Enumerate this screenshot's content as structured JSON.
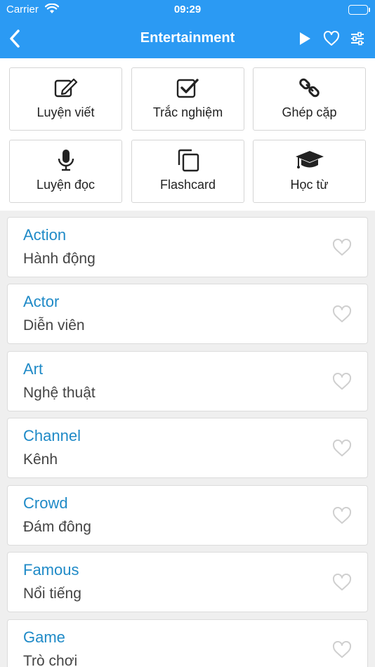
{
  "status_bar": {
    "carrier": "Carrier",
    "time": "09:29"
  },
  "nav": {
    "title": "Entertainment",
    "icons": [
      "chevron-left-icon",
      "play-icon",
      "heart-outline-icon",
      "sliders-icon"
    ]
  },
  "actions": [
    {
      "label": "Luyện viết",
      "icon": "edit-icon"
    },
    {
      "label": "Trắc nghiệm",
      "icon": "checkbox-icon"
    },
    {
      "label": "Ghép cặp",
      "icon": "link-icon"
    },
    {
      "label": "Luyện đọc",
      "icon": "microphone-icon"
    },
    {
      "label": "Flashcard",
      "icon": "copy-icon"
    },
    {
      "label": "Học từ",
      "icon": "graduation-cap-icon"
    }
  ],
  "words": [
    {
      "en": "Action",
      "vi": "Hành động"
    },
    {
      "en": "Actor",
      "vi": "Diễn viên"
    },
    {
      "en": "Art",
      "vi": "Nghệ thuật"
    },
    {
      "en": "Channel",
      "vi": "Kênh"
    },
    {
      "en": "Crowd",
      "vi": "Đám đông"
    },
    {
      "en": "Famous",
      "vi": "Nổi tiếng"
    },
    {
      "en": "Game",
      "vi": "Trò chơi"
    }
  ],
  "colors": {
    "header": "#2b9af3",
    "word_text": "#1f8ac7",
    "translation_text": "#444444",
    "background": "#efefef"
  }
}
